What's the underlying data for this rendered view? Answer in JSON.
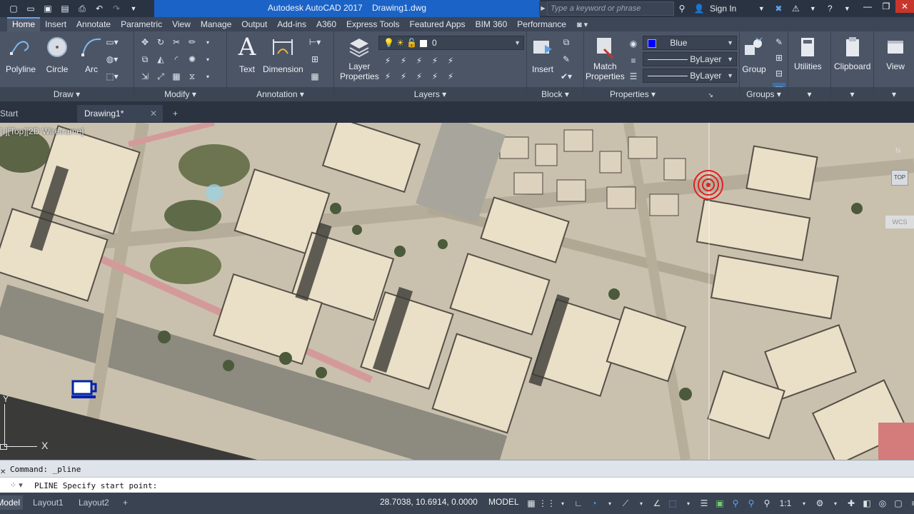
{
  "titlebar": {
    "app_title": "Autodesk AutoCAD 2017    Drawing1.dwg",
    "search_placeholder": "Type a keyword or phrase",
    "sign_in": "Sign In"
  },
  "ribbon_tabs": [
    "Home",
    "Insert",
    "Annotate",
    "Parametric",
    "View",
    "Manage",
    "Output",
    "Add-ins",
    "A360",
    "Express Tools",
    "Featured Apps",
    "BIM 360",
    "Performance"
  ],
  "ribbon": {
    "draw": {
      "title": "Draw",
      "polyline": "Polyline",
      "circle": "Circle",
      "arc": "Arc"
    },
    "modify": {
      "title": "Modify"
    },
    "annotation": {
      "title": "Annotation",
      "text": "Text",
      "dimension": "Dimension"
    },
    "layers": {
      "title": "Layers",
      "layer_properties_line1": "Layer",
      "layer_properties_line2": "Properties",
      "current_layer": "0"
    },
    "block": {
      "title": "Block",
      "insert": "Insert"
    },
    "properties": {
      "title": "Properties",
      "match_line1": "Match",
      "match_line2": "Properties",
      "color": "Blue",
      "color_hex": "#0000ff",
      "linetype": "ByLayer",
      "lineweight": "ByLayer"
    },
    "groups": {
      "title": "Groups",
      "group": "Group"
    },
    "utilities": "Utilities",
    "clipboard": "Clipboard",
    "view": "View"
  },
  "file_tabs": {
    "start": "Start",
    "drawing": "Drawing1*"
  },
  "viewport": {
    "label": "[-][Top][2D Wireframe]",
    "cube_top": "TOP",
    "cube_n": "N",
    "wcs": "WCS",
    "ucs_y": "Y",
    "ucs_x": "X"
  },
  "command": {
    "history": "Command:  _pline",
    "prompt": "PLINE Specify start point:"
  },
  "statusbar": {
    "model_tab": "Model",
    "layout1": "Layout1",
    "layout2": "Layout2",
    "coords": "28.7038, 10.6914, 0.0000",
    "model_btn": "MODEL",
    "scale": "1:1"
  },
  "colors": {
    "accent": "#1b63c6",
    "ribbon_bg": "#4c5566",
    "blue_swatch": "#0000ff"
  }
}
